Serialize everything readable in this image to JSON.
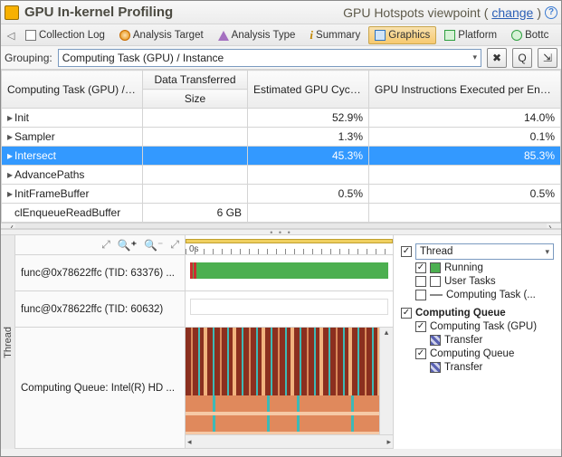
{
  "header": {
    "title": "GPU In-kernel Profiling",
    "viewpoint_prefix": "GPU Hotspots viewpoint (",
    "change_label": "change",
    "viewpoint_suffix": ")"
  },
  "tabs": {
    "items": [
      {
        "label": "Collection Log",
        "icon": "log-icon",
        "selected": false
      },
      {
        "label": "Analysis Target",
        "icon": "target-icon",
        "selected": false
      },
      {
        "label": "Analysis Type",
        "icon": "type-icon",
        "selected": false
      },
      {
        "label": "Summary",
        "icon": "summary-icon",
        "selected": false
      },
      {
        "label": "Graphics",
        "icon": "graphics-icon",
        "selected": true
      },
      {
        "label": "Platform",
        "icon": "platform-icon",
        "selected": false
      },
      {
        "label": "Bottc",
        "icon": "bottc-icon",
        "selected": false
      }
    ]
  },
  "grouping": {
    "label": "Grouping:",
    "value": "Computing Task (GPU) / Instance"
  },
  "table": {
    "headers": {
      "col0": "Computing Task (GPU) / Instance",
      "col1_top": "Data Transferred",
      "col1_bottom": "Size",
      "col2": "Estimated GPU Cycles",
      "col3": "GPU Instructions Executed per Enqueue"
    },
    "rows": [
      {
        "label": "Init",
        "size": "",
        "cycles": "52.9%",
        "instr": "14.0%",
        "expandable": true,
        "selected": false
      },
      {
        "label": "Sampler",
        "size": "",
        "cycles": "1.3%",
        "instr": "0.1%",
        "expandable": true,
        "selected": false
      },
      {
        "label": "Intersect",
        "size": "",
        "cycles": "45.3%",
        "instr": "85.3%",
        "expandable": true,
        "selected": true
      },
      {
        "label": "AdvancePaths",
        "size": "",
        "cycles": "",
        "instr": "",
        "expandable": true,
        "selected": false
      },
      {
        "label": "InitFrameBuffer",
        "size": "",
        "cycles": "0.5%",
        "instr": "0.5%",
        "expandable": true,
        "selected": false
      },
      {
        "label": "clEnqueueReadBuffer",
        "size": "6 GB",
        "cycles": "",
        "instr": "",
        "expandable": false,
        "selected": false
      }
    ]
  },
  "timeline": {
    "vertical_header": "Thread",
    "ruler_start": "0s",
    "rows": [
      {
        "label": "func@0x78622ffc (TID: 63376) ..."
      },
      {
        "label": "func@0x78622ffc (TID: 60632)"
      },
      {
        "label": "Computing Queue: Intel(R) HD ..."
      }
    ]
  },
  "legend": {
    "selector_value": "Thread",
    "group2_title": "Computing Queue",
    "items_top": [
      {
        "label": "Running",
        "swatch": "green"
      },
      {
        "label": "User Tasks",
        "swatch": "white"
      },
      {
        "label": "Computing Task (...",
        "swatch": "line"
      }
    ],
    "items_bottom": [
      {
        "label": "Computing Task (GPU)",
        "sub": "Transfer"
      },
      {
        "label": "Computing Queue",
        "sub": "Transfer"
      }
    ]
  },
  "icons": {
    "tools": "✖",
    "search": "Q",
    "tree": "⇲",
    "help": "?"
  }
}
